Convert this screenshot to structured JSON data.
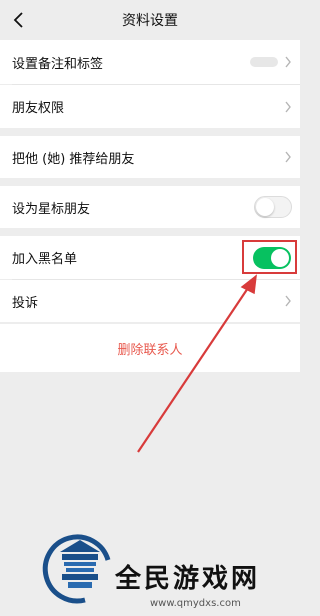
{
  "nav": {
    "title": "资料设置"
  },
  "rows": {
    "remark": {
      "label": "设置备注和标签"
    },
    "permission": {
      "label": "朋友权限"
    },
    "recommend": {
      "label": "把他 (她) 推荐给朋友"
    },
    "star": {
      "label": "设为星标朋友",
      "on": false
    },
    "blacklist": {
      "label": "加入黑名单",
      "on": true
    },
    "complain": {
      "label": "投诉"
    }
  },
  "delete": {
    "label": "删除联系人"
  },
  "watermark": {
    "site_name": "全民游戏网",
    "url": "www.qmydxs.com"
  },
  "colors": {
    "toggle_on": "#07c160",
    "annotation_red": "#d83b3b",
    "delete_text": "#e85a4f"
  },
  "icons": [
    "back-icon",
    "chevron-right-icon"
  ]
}
